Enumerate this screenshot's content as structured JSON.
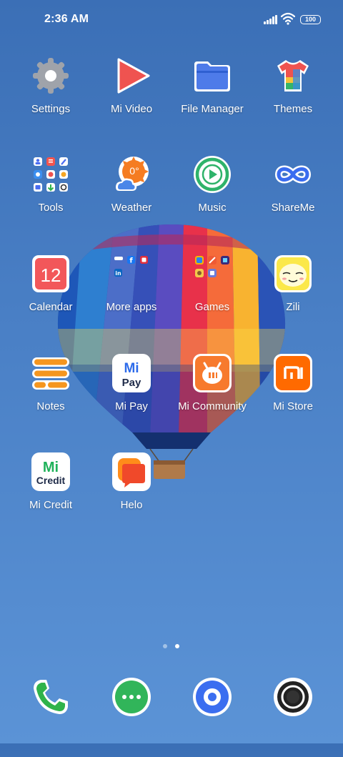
{
  "status_bar": {
    "time": "2:36 AM",
    "battery": "100",
    "icons": [
      "signal-icon",
      "wifi-icon",
      "battery-icon"
    ]
  },
  "apps": [
    {
      "label": "Settings",
      "icon": "gear-icon"
    },
    {
      "label": "Mi Video",
      "icon": "play-icon"
    },
    {
      "label": "File Manager",
      "icon": "folder-icon"
    },
    {
      "label": "Themes",
      "icon": "tshirt-icon"
    },
    {
      "label": "Tools",
      "icon": "tools-folder-icon"
    },
    {
      "label": "Weather",
      "icon": "sun-cloud-icon",
      "icon_text": "0°"
    },
    {
      "label": "Music",
      "icon": "music-play-icon"
    },
    {
      "label": "ShareMe",
      "icon": "infinity-icon"
    },
    {
      "label": "Calendar",
      "icon": "calendar-icon",
      "icon_text": "12"
    },
    {
      "label": "More apps",
      "icon": "more-apps-folder-icon"
    },
    {
      "label": "Games",
      "icon": "games-folder-icon"
    },
    {
      "label": "Zili",
      "icon": "zili-face-icon"
    },
    {
      "label": "Notes",
      "icon": "notes-icon"
    },
    {
      "label": "Mi Pay",
      "icon": "mi-pay-icon",
      "icon_text_1": "Mi",
      "icon_text_2": "Pay"
    },
    {
      "label": "Mi Community",
      "icon": "mi-community-icon"
    },
    {
      "label": "Mi Store",
      "icon": "mi-store-icon"
    },
    {
      "label": "Mi Credit",
      "icon": "mi-credit-icon",
      "icon_text_1": "Mi",
      "icon_text_2": "Credit"
    },
    {
      "label": "Helo",
      "icon": "helo-icon"
    }
  ],
  "page_indicator": {
    "count": 2,
    "active": 2
  },
  "dock": [
    {
      "icon": "phone-icon"
    },
    {
      "icon": "messages-icon"
    },
    {
      "icon": "browser-icon"
    },
    {
      "icon": "camera-icon"
    }
  ],
  "colors": {
    "wallpaper_top": "#3b6fb6",
    "wallpaper_bottom": "#5b93d6",
    "accent_red": "#ef5350",
    "accent_green": "#2fb34a",
    "mi_orange": "#ff6a00"
  }
}
